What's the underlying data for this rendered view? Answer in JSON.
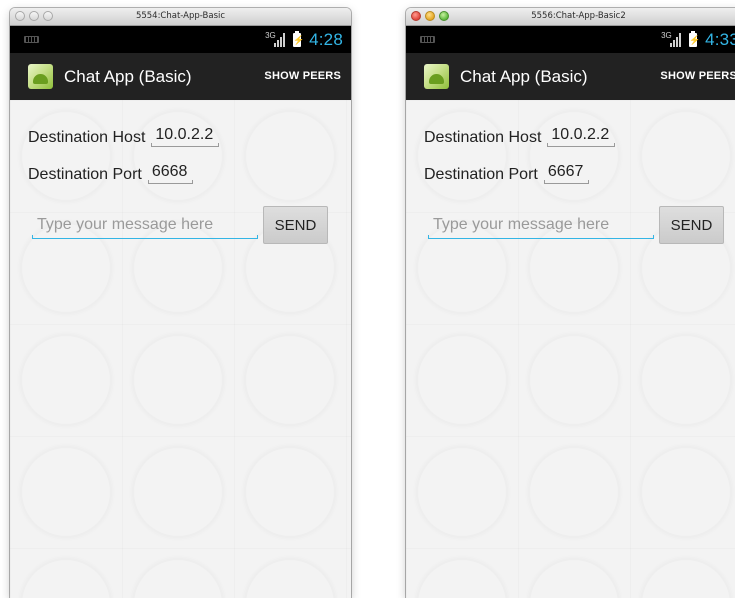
{
  "windows": [
    {
      "title": "5554:Chat-App-Basic",
      "titlebar_state": "inactive",
      "status": {
        "network": "3G",
        "time": "4:28"
      },
      "app_title": "Chat App (Basic)",
      "show_peers_label": "SHOW PEERS",
      "host_label": "Destination Host",
      "host_value": "10.0.2.2",
      "port_label": "Destination Port",
      "port_value": "6668",
      "message_placeholder": "Type your message here",
      "send_label": "SEND"
    },
    {
      "title": "5556:Chat-App-Basic2",
      "titlebar_state": "active",
      "status": {
        "network": "3G",
        "time": "4:33"
      },
      "app_title": "Chat App (Basic)",
      "show_peers_label": "SHOW PEERS",
      "host_label": "Destination Host",
      "host_value": "10.0.2.2",
      "port_label": "Destination Port",
      "port_value": "6667",
      "message_placeholder": "Type your message here",
      "send_label": "SEND"
    }
  ],
  "colors": {
    "accent": "#33b5e5",
    "action_bar": "#222222",
    "status_bar": "#000000",
    "background": "#f3f3f3"
  },
  "icons": {
    "keyboard": "keyboard-icon",
    "signal": "signal-icon",
    "battery": "battery-charging-icon",
    "app": "android-app-icon"
  }
}
